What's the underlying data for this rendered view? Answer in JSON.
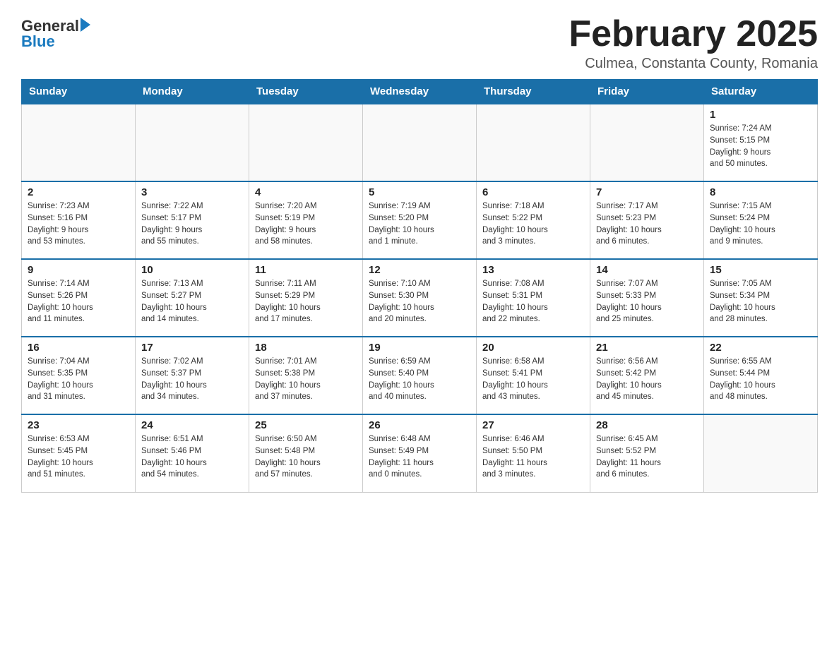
{
  "header": {
    "logo_text1": "General",
    "logo_text2": "Blue",
    "month_title": "February 2025",
    "location": "Culmea, Constanta County, Romania"
  },
  "weekdays": [
    "Sunday",
    "Monday",
    "Tuesday",
    "Wednesday",
    "Thursday",
    "Friday",
    "Saturday"
  ],
  "weeks": [
    [
      {
        "day": "",
        "info": ""
      },
      {
        "day": "",
        "info": ""
      },
      {
        "day": "",
        "info": ""
      },
      {
        "day": "",
        "info": ""
      },
      {
        "day": "",
        "info": ""
      },
      {
        "day": "",
        "info": ""
      },
      {
        "day": "1",
        "info": "Sunrise: 7:24 AM\nSunset: 5:15 PM\nDaylight: 9 hours\nand 50 minutes."
      }
    ],
    [
      {
        "day": "2",
        "info": "Sunrise: 7:23 AM\nSunset: 5:16 PM\nDaylight: 9 hours\nand 53 minutes."
      },
      {
        "day": "3",
        "info": "Sunrise: 7:22 AM\nSunset: 5:17 PM\nDaylight: 9 hours\nand 55 minutes."
      },
      {
        "day": "4",
        "info": "Sunrise: 7:20 AM\nSunset: 5:19 PM\nDaylight: 9 hours\nand 58 minutes."
      },
      {
        "day": "5",
        "info": "Sunrise: 7:19 AM\nSunset: 5:20 PM\nDaylight: 10 hours\nand 1 minute."
      },
      {
        "day": "6",
        "info": "Sunrise: 7:18 AM\nSunset: 5:22 PM\nDaylight: 10 hours\nand 3 minutes."
      },
      {
        "day": "7",
        "info": "Sunrise: 7:17 AM\nSunset: 5:23 PM\nDaylight: 10 hours\nand 6 minutes."
      },
      {
        "day": "8",
        "info": "Sunrise: 7:15 AM\nSunset: 5:24 PM\nDaylight: 10 hours\nand 9 minutes."
      }
    ],
    [
      {
        "day": "9",
        "info": "Sunrise: 7:14 AM\nSunset: 5:26 PM\nDaylight: 10 hours\nand 11 minutes."
      },
      {
        "day": "10",
        "info": "Sunrise: 7:13 AM\nSunset: 5:27 PM\nDaylight: 10 hours\nand 14 minutes."
      },
      {
        "day": "11",
        "info": "Sunrise: 7:11 AM\nSunset: 5:29 PM\nDaylight: 10 hours\nand 17 minutes."
      },
      {
        "day": "12",
        "info": "Sunrise: 7:10 AM\nSunset: 5:30 PM\nDaylight: 10 hours\nand 20 minutes."
      },
      {
        "day": "13",
        "info": "Sunrise: 7:08 AM\nSunset: 5:31 PM\nDaylight: 10 hours\nand 22 minutes."
      },
      {
        "day": "14",
        "info": "Sunrise: 7:07 AM\nSunset: 5:33 PM\nDaylight: 10 hours\nand 25 minutes."
      },
      {
        "day": "15",
        "info": "Sunrise: 7:05 AM\nSunset: 5:34 PM\nDaylight: 10 hours\nand 28 minutes."
      }
    ],
    [
      {
        "day": "16",
        "info": "Sunrise: 7:04 AM\nSunset: 5:35 PM\nDaylight: 10 hours\nand 31 minutes."
      },
      {
        "day": "17",
        "info": "Sunrise: 7:02 AM\nSunset: 5:37 PM\nDaylight: 10 hours\nand 34 minutes."
      },
      {
        "day": "18",
        "info": "Sunrise: 7:01 AM\nSunset: 5:38 PM\nDaylight: 10 hours\nand 37 minutes."
      },
      {
        "day": "19",
        "info": "Sunrise: 6:59 AM\nSunset: 5:40 PM\nDaylight: 10 hours\nand 40 minutes."
      },
      {
        "day": "20",
        "info": "Sunrise: 6:58 AM\nSunset: 5:41 PM\nDaylight: 10 hours\nand 43 minutes."
      },
      {
        "day": "21",
        "info": "Sunrise: 6:56 AM\nSunset: 5:42 PM\nDaylight: 10 hours\nand 45 minutes."
      },
      {
        "day": "22",
        "info": "Sunrise: 6:55 AM\nSunset: 5:44 PM\nDaylight: 10 hours\nand 48 minutes."
      }
    ],
    [
      {
        "day": "23",
        "info": "Sunrise: 6:53 AM\nSunset: 5:45 PM\nDaylight: 10 hours\nand 51 minutes."
      },
      {
        "day": "24",
        "info": "Sunrise: 6:51 AM\nSunset: 5:46 PM\nDaylight: 10 hours\nand 54 minutes."
      },
      {
        "day": "25",
        "info": "Sunrise: 6:50 AM\nSunset: 5:48 PM\nDaylight: 10 hours\nand 57 minutes."
      },
      {
        "day": "26",
        "info": "Sunrise: 6:48 AM\nSunset: 5:49 PM\nDaylight: 11 hours\nand 0 minutes."
      },
      {
        "day": "27",
        "info": "Sunrise: 6:46 AM\nSunset: 5:50 PM\nDaylight: 11 hours\nand 3 minutes."
      },
      {
        "day": "28",
        "info": "Sunrise: 6:45 AM\nSunset: 5:52 PM\nDaylight: 11 hours\nand 6 minutes."
      },
      {
        "day": "",
        "info": ""
      }
    ]
  ]
}
